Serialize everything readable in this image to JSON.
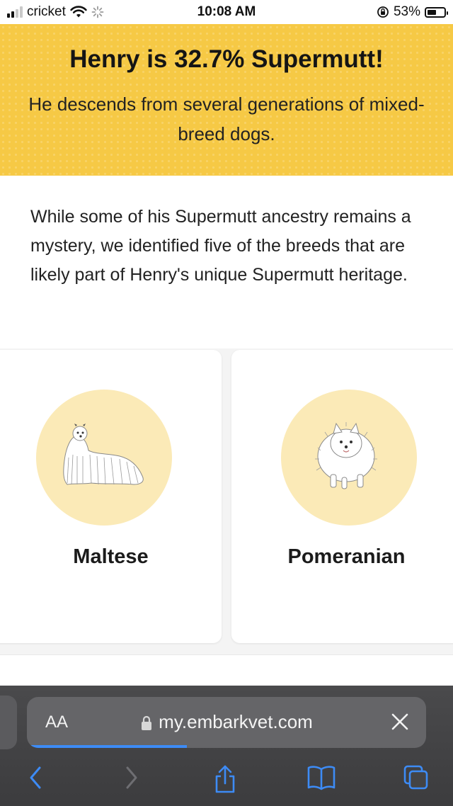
{
  "status_bar": {
    "carrier": "cricket",
    "time": "10:08 AM",
    "battery": "53%",
    "battery_level": 0.53
  },
  "hero": {
    "headline": "Henry is 32.7% Supermutt!",
    "subtext": "He descends from several generations of mixed-breed dogs."
  },
  "intro": {
    "text": "While some of his Supermutt ancestry remains a mystery, we identified five of the breeds that are likely part of Henry's unique Supermutt heritage."
  },
  "breeds": [
    {
      "name": "Maltese",
      "icon": "maltese-dog-illustration"
    },
    {
      "name": "Pomeranian",
      "icon": "pomeranian-dog-illustration"
    }
  ],
  "browser": {
    "text_size_label": "AA",
    "url": "my.embarkvet.com",
    "load_progress": 0.4
  },
  "colors": {
    "hero_yellow": "#f6c945",
    "breed_circle": "#fbeab7",
    "progress_blue": "#3d8bf5",
    "toolbar_blue": "#3d8bf5"
  }
}
